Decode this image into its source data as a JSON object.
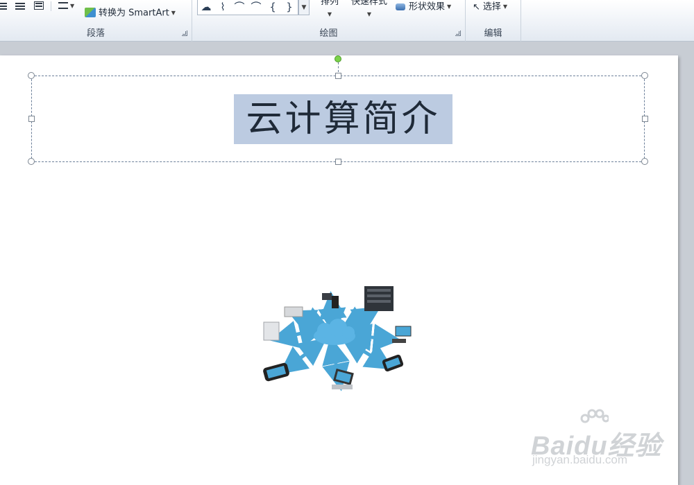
{
  "ribbon": {
    "convert_smartart": "转换为 SmartArt",
    "paragraph_group": "段落",
    "drawing_group": "绘图",
    "editing_group": "编辑",
    "arrange_label": "排列",
    "quick_styles_label": "快速样式",
    "shape_effects_label": "形状效果",
    "select_label": "选择",
    "shape_gallery": [
      "☁",
      "⌇",
      "⌒",
      "⌒",
      "{",
      "}"
    ]
  },
  "slide": {
    "title": "云计算简介",
    "image_icon": "cloud-network-illustration"
  },
  "watermark": {
    "brand": "Baidu经验",
    "url": "jingyan.baidu.com"
  },
  "colors": {
    "selection": "#bccbe1",
    "arrow": "#4aa6d6",
    "cloud": "#5bb4e4"
  }
}
